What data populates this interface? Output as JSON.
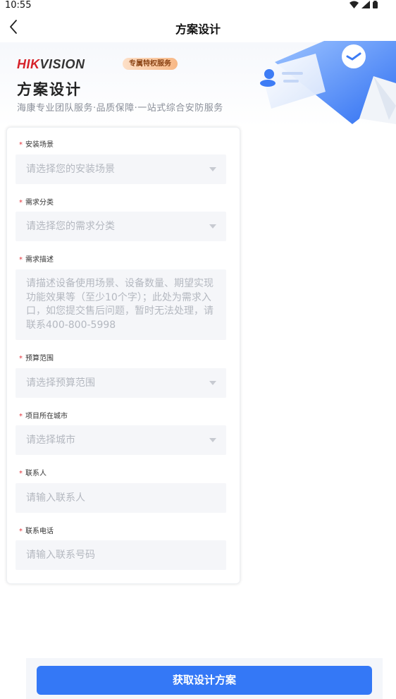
{
  "status_bar": {
    "time": "10:55"
  },
  "nav": {
    "title": "方案设计"
  },
  "banner": {
    "brand_red": "HIK",
    "brand_dark": "VISION",
    "badge": "专属特权服务",
    "title": "方案设计",
    "subtitle": "海康专业团队服务·品质保障·一站式综合安防服务"
  },
  "form": {
    "required_mark": "*",
    "fields": [
      {
        "label": "安装场景",
        "placeholder": "请选择您的安装场景",
        "type": "select"
      },
      {
        "label": "需求分类",
        "placeholder": "请选择您的需求分类",
        "type": "select"
      },
      {
        "label": "需求描述",
        "placeholder": "请描述设备使用场景、设备数量、期望实现功能效果等（至少10个字）；此处为需求入口，如您提交售后问题，暂时无法处理，请联系400-800-5998",
        "type": "textarea"
      },
      {
        "label": "预算范围",
        "placeholder": "请选择预算范围",
        "type": "select"
      },
      {
        "label": "项目所在城市",
        "placeholder": "请选择城市",
        "type": "select"
      },
      {
        "label": "联系人",
        "placeholder": "请输入联系人",
        "type": "input"
      },
      {
        "label": "联系电话",
        "placeholder": "请输入联系号码",
        "type": "input"
      }
    ]
  },
  "submit": {
    "label": "获取设计方案"
  },
  "colors": {
    "accent": "#3478f6",
    "required": "#e2343c",
    "brand_red": "#d6222a"
  }
}
